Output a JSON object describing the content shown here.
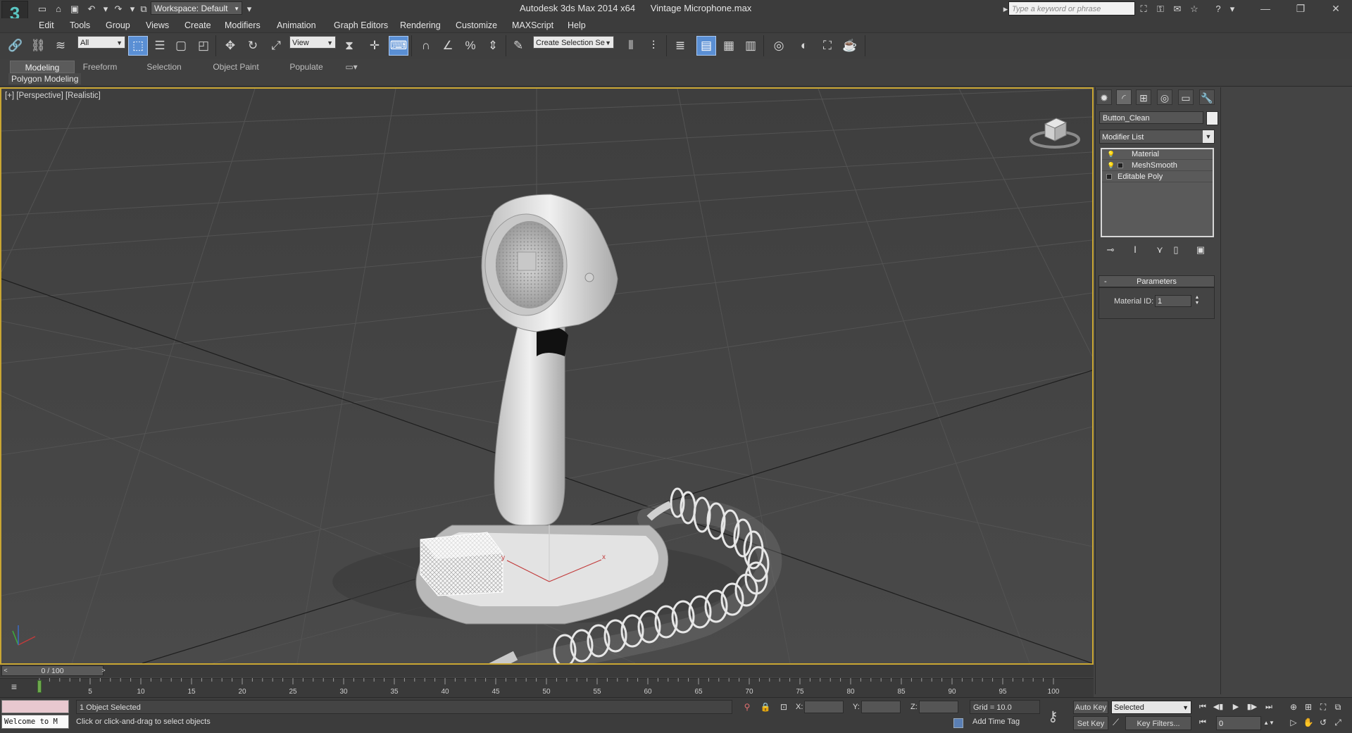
{
  "titlebar": {
    "workspace": "Workspace: Default",
    "app_name": "Autodesk 3ds Max  2014 x64",
    "file_name": "Vintage Microphone.max",
    "search_placeholder": "Type a keyword or phrase"
  },
  "menu": [
    "Edit",
    "Tools",
    "Group",
    "Views",
    "Create",
    "Modifiers",
    "Animation",
    "Graph Editors",
    "Rendering",
    "Customize",
    "MAXScript",
    "Help"
  ],
  "toolbar": {
    "filter_value": "All",
    "refcoord_value": "View",
    "named_selection_placeholder": "Create Selection Se"
  },
  "ribbon": {
    "tabs": [
      "Modeling",
      "Freeform",
      "Selection",
      "Object Paint",
      "Populate"
    ],
    "active_tab": "Modeling",
    "panel_label": "Polygon Modeling"
  },
  "viewport": {
    "label": "[+] [Perspective] [Realistic]"
  },
  "command_panel": {
    "object_name": "Button_Clean",
    "modifier_list": "Modifier List",
    "stack": [
      "Material",
      "MeshSmooth",
      "Editable Poly"
    ],
    "rollout_title": "Parameters",
    "material_id_label": "Material ID:",
    "material_id_value": "1"
  },
  "timeline": {
    "position": "0 / 100",
    "ticks": [
      "5",
      "10",
      "15",
      "20",
      "25",
      "30",
      "35",
      "40",
      "45",
      "50",
      "55",
      "60",
      "65",
      "70",
      "75",
      "80",
      "85",
      "90",
      "95",
      "100"
    ]
  },
  "status": {
    "maxscript": "Welcome to M",
    "selection": "1 Object Selected",
    "prompt": "Click or click-and-drag to select objects",
    "x_label": "X:",
    "y_label": "Y:",
    "z_label": "Z:",
    "grid": "Grid = 10.0",
    "add_time_tag": "Add Time Tag",
    "auto_key": "Auto Key",
    "set_key": "Set Key",
    "key_mode": "Selected",
    "key_filters": "Key Filters...",
    "current_frame": "0"
  },
  "colors": {
    "viewport_border": "#c9a633",
    "active_button": "#5a8fd4",
    "background": "#444444"
  }
}
